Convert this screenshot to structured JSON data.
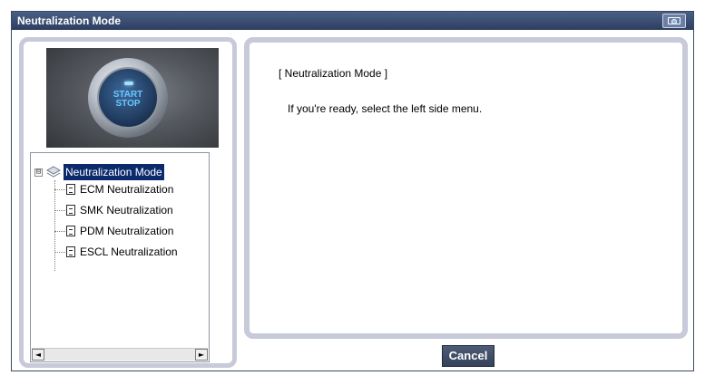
{
  "window": {
    "title": "Neutralization Mode",
    "capture_icon": "camera-icon"
  },
  "left_panel": {
    "start_button": {
      "line1": "START",
      "line2": "STOP"
    },
    "tree": {
      "root": {
        "label": "Neutralization Mode",
        "expander": "⊟",
        "icon": "stack-icon",
        "selected": true
      },
      "items": [
        {
          "label": "ECM Neutralization",
          "icon": "document-icon"
        },
        {
          "label": "SMK Neutralization",
          "icon": "document-icon"
        },
        {
          "label": "PDM Neutralization",
          "icon": "document-icon"
        },
        {
          "label": "ESCL Neutralization",
          "icon": "document-icon"
        }
      ],
      "scroll_left": "◄",
      "scroll_right": "►"
    }
  },
  "right_panel": {
    "heading": "[ Neutralization Mode ]",
    "message": "If you're ready, select the left side menu."
  },
  "buttons": {
    "cancel": "Cancel"
  },
  "colors": {
    "titlebar": "#2c3e60",
    "panel_border": "#c6cad9",
    "selection": "#0b2a6c",
    "button": "#3f4d67"
  }
}
